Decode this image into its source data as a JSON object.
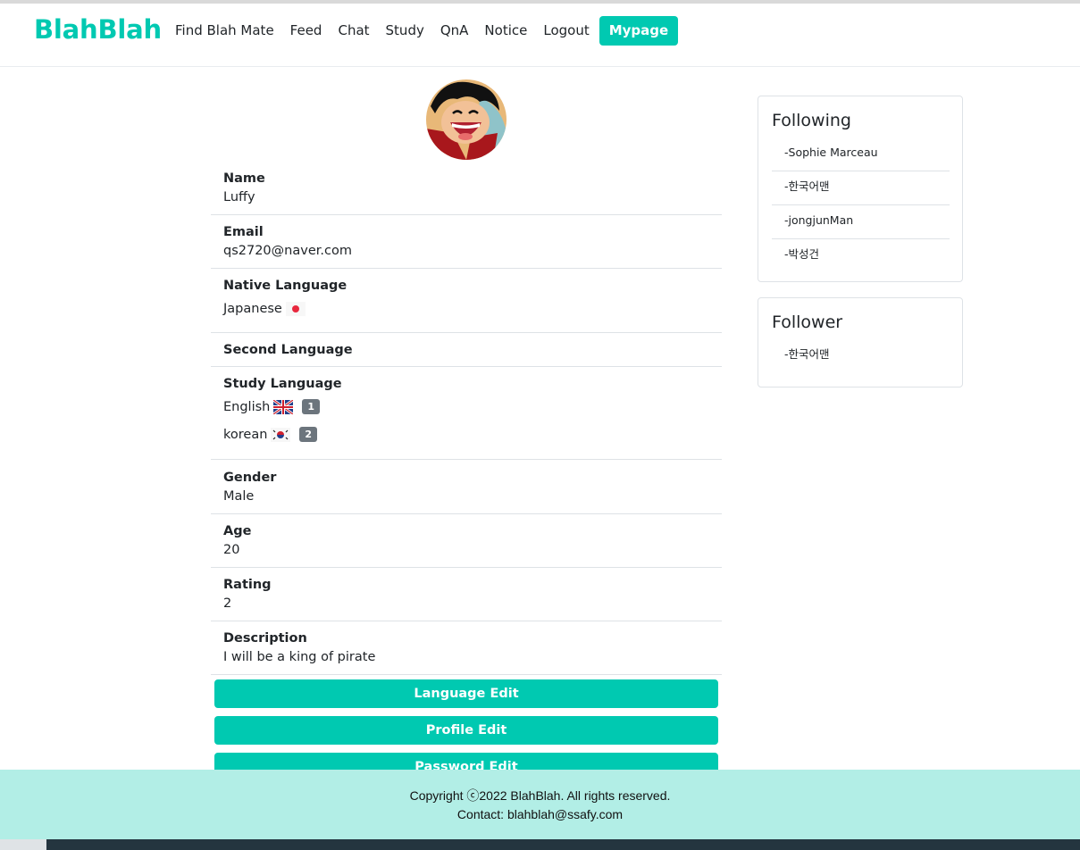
{
  "nav": {
    "brand": "BlahBlah",
    "links": [
      "Find Blah Mate",
      "Feed",
      "Chat",
      "Study",
      "QnA",
      "Notice",
      "Logout"
    ],
    "active": "Mypage",
    "accent": "#00c9b1"
  },
  "profile": {
    "name_label": "Name",
    "name": "Luffy",
    "email_label": "Email",
    "email": "qs2720@naver.com",
    "native_label": "Native Language",
    "native": "Japanese",
    "native_flag": "japan-flag-icon",
    "second_label": "Second Language",
    "study_label": "Study Language",
    "study": [
      {
        "lang": "English",
        "flag": "uk-flag-icon",
        "level": "1"
      },
      {
        "lang": "korean",
        "flag": "korea-flag-icon",
        "level": "2"
      }
    ],
    "gender_label": "Gender",
    "gender": "Male",
    "age_label": "Age",
    "age": "20",
    "rating_label": "Rating",
    "rating": "2",
    "desc_label": "Description",
    "desc": "I will be a king of pirate"
  },
  "buttons": {
    "language_edit": "Language Edit",
    "profile_edit": "Profile Edit",
    "password_edit": "Password Edit"
  },
  "following": {
    "title": "Following",
    "items": [
      "-Sophie Marceau",
      "-한국어맨",
      "-jongjunMan",
      "-박성건"
    ]
  },
  "follower": {
    "title": "Follower",
    "items": [
      "-한국어맨"
    ]
  },
  "footer": {
    "copyright": "Copyright ⓒ2022 BlahBlah. All rights reserved.",
    "contact": "Contact: blahblah@ssafy.com",
    "bg": "#b2eee6"
  }
}
